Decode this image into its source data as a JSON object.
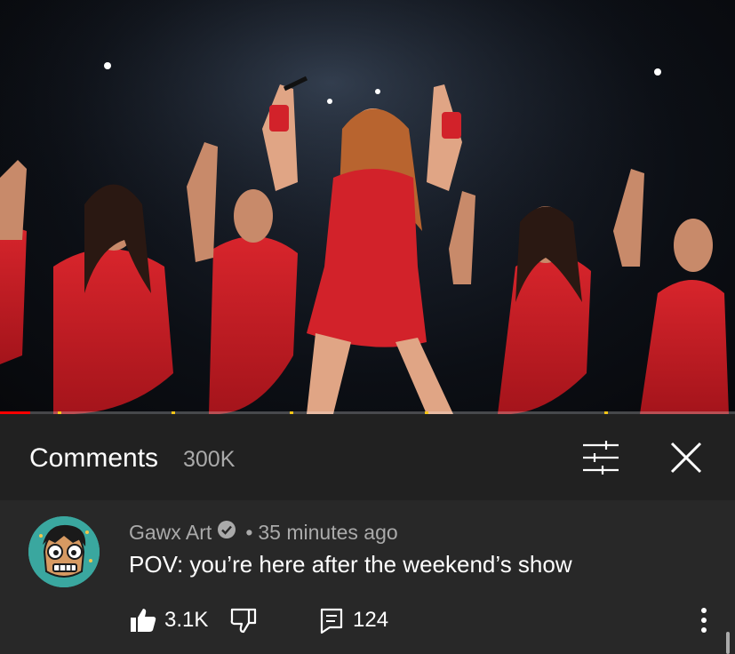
{
  "video": {
    "progress_fraction": 0.041,
    "colors": {
      "progress": "#ff0000",
      "ad_marker": "#f5c518"
    }
  },
  "comments_header": {
    "title": "Comments",
    "count": "300K",
    "filter_icon": "sliders-icon",
    "close_icon": "close-icon"
  },
  "comment": {
    "author": "Gawx Art",
    "verified_icon": "verified-check-icon",
    "separator": "•",
    "time": "35 minutes ago",
    "text": "POV: you’re here after the weekend’s show",
    "likes": "3.1K",
    "replies": "124",
    "like_icon": "thumbs-up-icon",
    "dislike_icon": "thumbs-down-icon",
    "reply_icon": "comment-icon",
    "more_icon": "more-vertical-icon"
  }
}
